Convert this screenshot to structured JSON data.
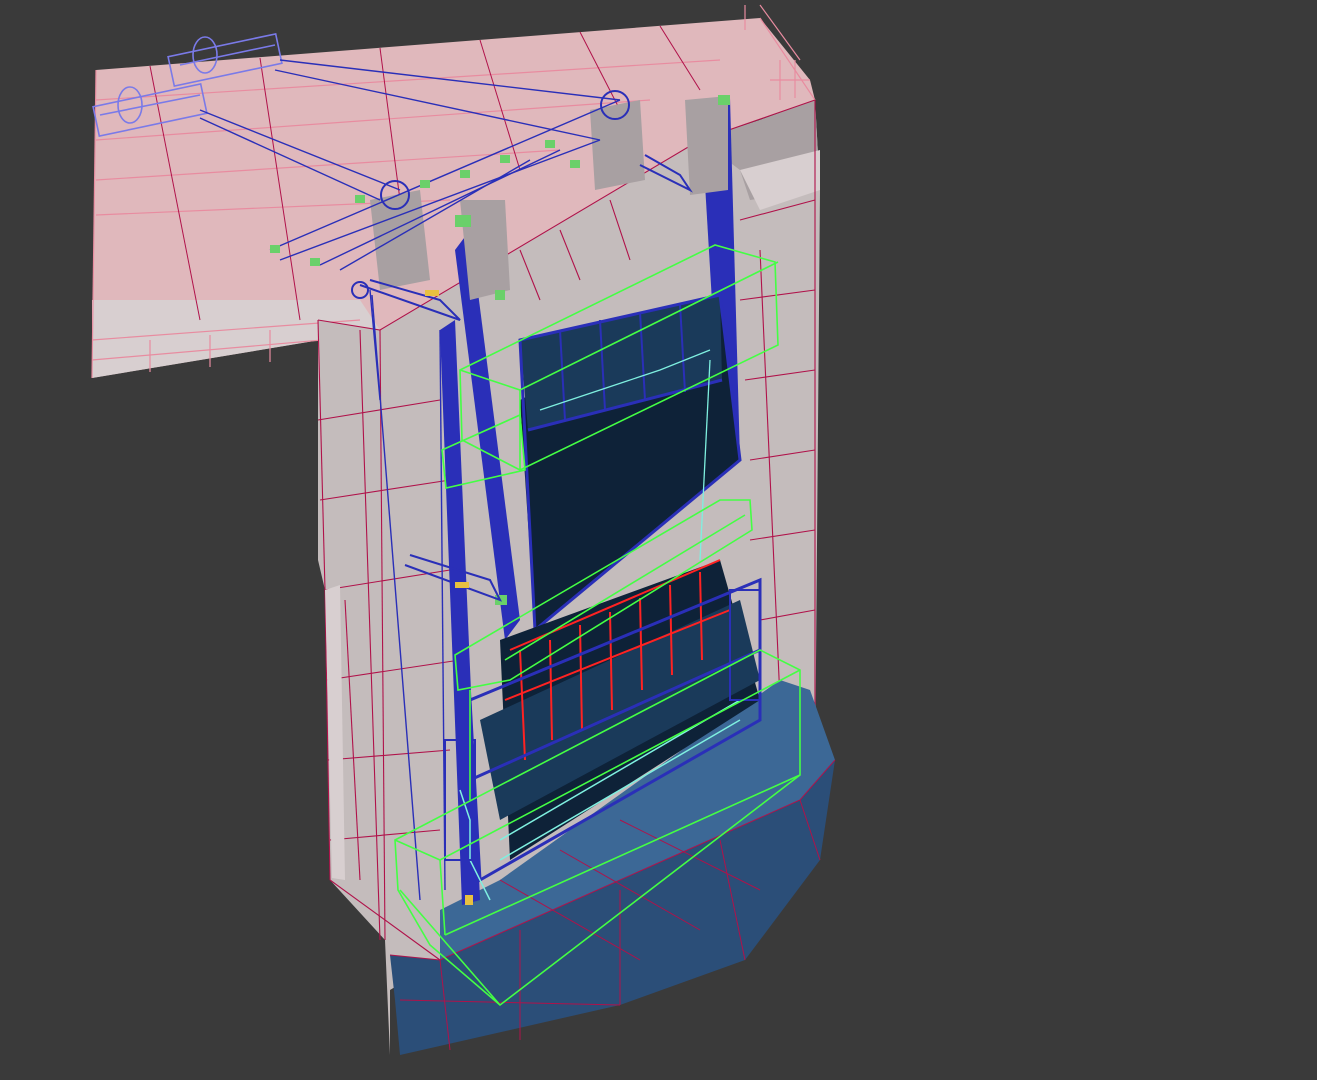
{
  "viewport": {
    "background": "#3a3a3a",
    "colors": {
      "concrete": "#c4bcbc",
      "concrete_dark": "#a8a0a2",
      "concrete_light": "#d8cfd0",
      "edge": "#b0124a",
      "pink_wire": "#e88ca0",
      "deck": "#e0b8bc",
      "gate_frame": "#2a2fb8",
      "gate_panel": "#0e2238",
      "gate_panel_light": "#1a3a5a",
      "base_block": "#2b4e78",
      "base_block_light": "#3c6896",
      "selection": "#44ff44",
      "cable": "#2a2fb8",
      "accent_red": "#ff2222",
      "accent_cyan": "#7ff0e0",
      "pulley_green": "#6ad06a",
      "hoist": "#7a7ae8"
    }
  }
}
